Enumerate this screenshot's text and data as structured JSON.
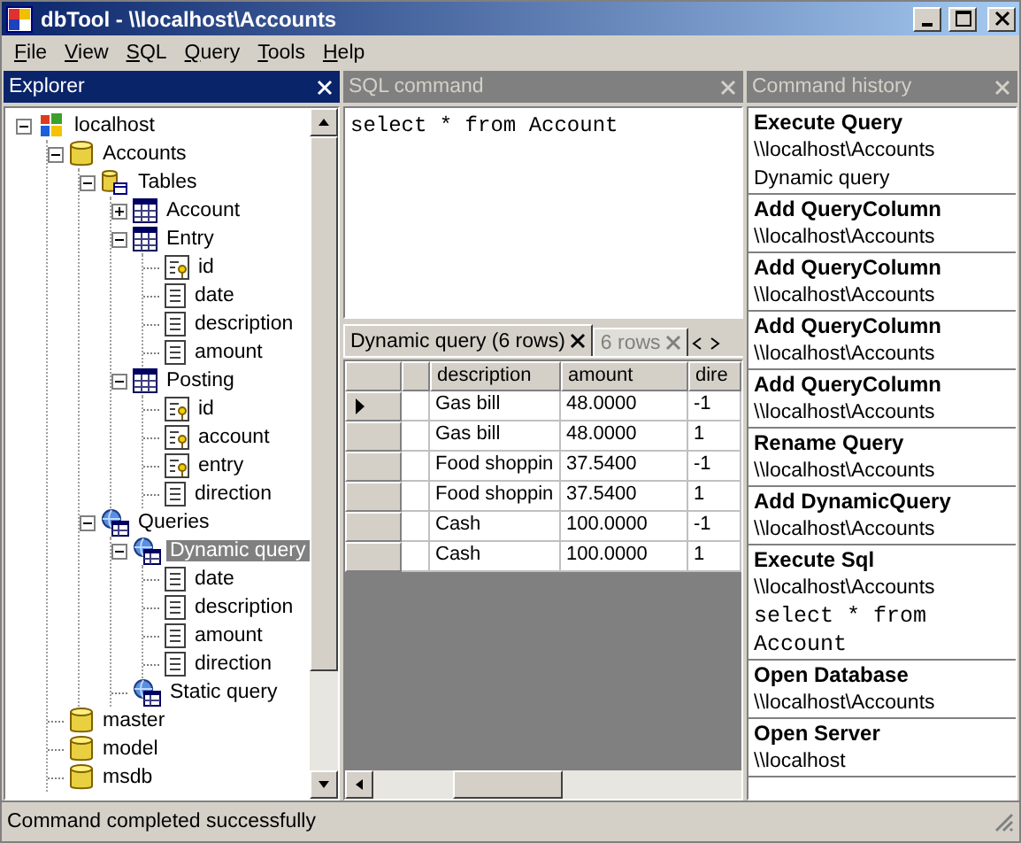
{
  "window": {
    "title": "dbTool - \\\\localhost\\Accounts"
  },
  "menu": [
    "File",
    "View",
    "SQL",
    "Query",
    "Tools",
    "Help"
  ],
  "explorer": {
    "title": "Explorer",
    "active": true,
    "tree": [
      {
        "label": "localhost",
        "kind": "server",
        "expanded": true,
        "selected": false,
        "children": [
          {
            "label": "Accounts",
            "kind": "database",
            "expanded": true,
            "selected": false,
            "children": [
              {
                "label": "Tables",
                "kind": "tables",
                "expanded": true,
                "selected": false,
                "children": [
                  {
                    "label": "Account",
                    "kind": "table",
                    "expanded": false,
                    "selected": false
                  },
                  {
                    "label": "Entry",
                    "kind": "table",
                    "expanded": true,
                    "selected": false,
                    "children": [
                      {
                        "label": "id",
                        "kind": "key",
                        "selected": false
                      },
                      {
                        "label": "date",
                        "kind": "column",
                        "selected": false
                      },
                      {
                        "label": "description",
                        "kind": "column",
                        "selected": false
                      },
                      {
                        "label": "amount",
                        "kind": "column",
                        "selected": false
                      }
                    ]
                  },
                  {
                    "label": "Posting",
                    "kind": "table",
                    "expanded": true,
                    "selected": false,
                    "children": [
                      {
                        "label": "id",
                        "kind": "key",
                        "selected": false
                      },
                      {
                        "label": "account",
                        "kind": "key",
                        "selected": false
                      },
                      {
                        "label": "entry",
                        "kind": "key",
                        "selected": false
                      },
                      {
                        "label": "direction",
                        "kind": "column",
                        "selected": false
                      }
                    ]
                  }
                ]
              },
              {
                "label": "Queries",
                "kind": "query",
                "expanded": true,
                "selected": false,
                "children": [
                  {
                    "label": "Dynamic query",
                    "kind": "query",
                    "expanded": true,
                    "selected": true,
                    "children": [
                      {
                        "label": "date",
                        "kind": "column",
                        "selected": false
                      },
                      {
                        "label": "description",
                        "kind": "column",
                        "selected": false
                      },
                      {
                        "label": "amount",
                        "kind": "column",
                        "selected": false
                      },
                      {
                        "label": "direction",
                        "kind": "column",
                        "selected": false
                      }
                    ]
                  },
                  {
                    "label": "Static query",
                    "kind": "query",
                    "selected": false
                  }
                ]
              }
            ]
          },
          {
            "label": "master",
            "kind": "database",
            "selected": false
          },
          {
            "label": "model",
            "kind": "database",
            "selected": false
          },
          {
            "label": "msdb",
            "kind": "database",
            "selected": false
          }
        ]
      }
    ]
  },
  "sql": {
    "title": "SQL command",
    "active": false,
    "text": "select * from Account",
    "result_tabs": [
      {
        "label": "Dynamic query (6 rows)",
        "selected": true
      },
      {
        "label": "6 rows",
        "selected": false
      }
    ],
    "columns": [
      "description",
      "amount",
      "dire"
    ],
    "rows": [
      {
        "current": true,
        "cells": [
          "Gas bill",
          "48.0000",
          "-1"
        ]
      },
      {
        "current": false,
        "cells": [
          "Gas bill",
          "48.0000",
          "1"
        ]
      },
      {
        "current": false,
        "cells": [
          "Food shoppin",
          "37.5400",
          "-1"
        ]
      },
      {
        "current": false,
        "cells": [
          "Food shoppin",
          "37.5400",
          "1"
        ]
      },
      {
        "current": false,
        "cells": [
          "Cash",
          "100.0000",
          "-1"
        ]
      },
      {
        "current": false,
        "cells": [
          "Cash",
          "100.0000",
          "1"
        ]
      }
    ]
  },
  "history": {
    "title": "Command history",
    "active": false,
    "entries": [
      {
        "title": "Execute Query",
        "lines": [
          {
            "kind": "path",
            "text": "\\\\localhost\\Accounts"
          },
          {
            "kind": "path",
            "text": "Dynamic query"
          }
        ]
      },
      {
        "title": "Add QueryColumn",
        "lines": [
          {
            "kind": "path",
            "text": "\\\\localhost\\Accounts"
          }
        ]
      },
      {
        "title": "Add QueryColumn",
        "lines": [
          {
            "kind": "path",
            "text": "\\\\localhost\\Accounts"
          }
        ]
      },
      {
        "title": "Add QueryColumn",
        "lines": [
          {
            "kind": "path",
            "text": "\\\\localhost\\Accounts"
          }
        ]
      },
      {
        "title": "Add QueryColumn",
        "lines": [
          {
            "kind": "path",
            "text": "\\\\localhost\\Accounts"
          }
        ]
      },
      {
        "title": "Rename Query",
        "lines": [
          {
            "kind": "path",
            "text": "\\\\localhost\\Accounts"
          }
        ]
      },
      {
        "title": "Add DynamicQuery",
        "lines": [
          {
            "kind": "path",
            "text": "\\\\localhost\\Accounts"
          }
        ]
      },
      {
        "title": "Execute Sql",
        "lines": [
          {
            "kind": "path",
            "text": "\\\\localhost\\Accounts"
          },
          {
            "kind": "sql",
            "text": "select * from Account"
          }
        ]
      },
      {
        "title": "Open Database",
        "lines": [
          {
            "kind": "path",
            "text": "\\\\localhost\\Accounts"
          }
        ]
      },
      {
        "title": "Open Server",
        "lines": [
          {
            "kind": "path",
            "text": "\\\\localhost"
          }
        ]
      }
    ]
  },
  "status_bar": "Command completed successfully"
}
